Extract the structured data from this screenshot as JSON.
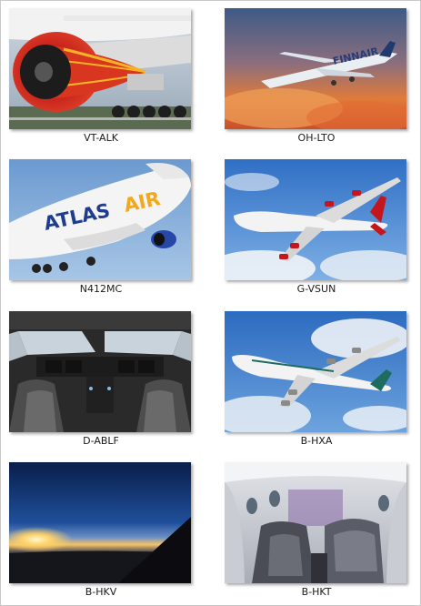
{
  "gallery": {
    "items": [
      {
        "label": "VT-ALK"
      },
      {
        "label": "OH-LTO"
      },
      {
        "label": "N412MC"
      },
      {
        "label": "G-VSUN"
      },
      {
        "label": "D-ABLF"
      },
      {
        "label": "B-HXA"
      },
      {
        "label": "B-HKV"
      },
      {
        "label": "B-HKT"
      }
    ],
    "logo_texts": {
      "finnair": "FINNAIR",
      "atlas": "ATLAS",
      "air": "AIR"
    }
  }
}
